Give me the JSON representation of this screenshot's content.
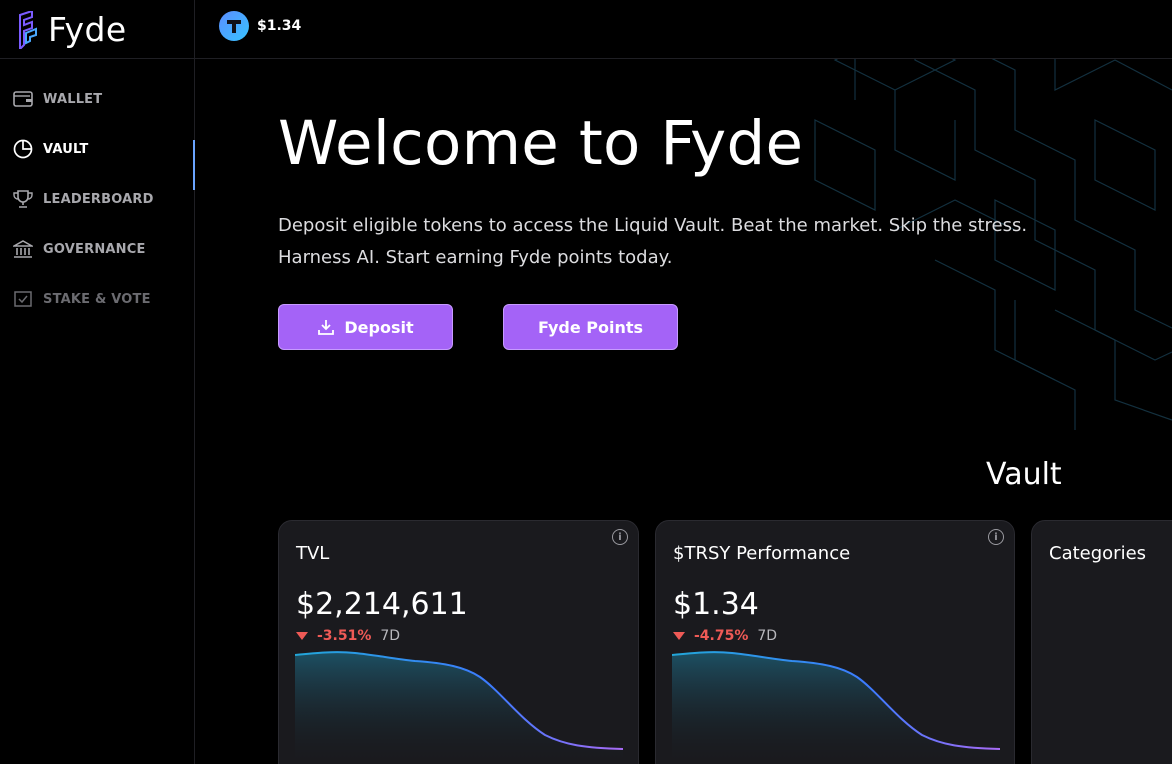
{
  "brand": {
    "name": "Fyde"
  },
  "header": {
    "token_price": "$1.34"
  },
  "sidebar": {
    "items": [
      {
        "label": "WALLET",
        "icon": "wallet-icon"
      },
      {
        "label": "VAULT",
        "icon": "pie-chart-icon",
        "active": true
      },
      {
        "label": "LEADERBOARD",
        "icon": "trophy-icon"
      },
      {
        "label": "GOVERNANCE",
        "icon": "bank-icon"
      },
      {
        "label": "STAKE & VOTE",
        "icon": "vote-icon"
      }
    ]
  },
  "hero": {
    "title": "Welcome to Fyde",
    "subtitle": "Deposit eligible tokens to access the Liquid Vault. Beat the market. Skip the stress. Harness AI. Start earning Fyde points today.",
    "deposit_label": "Deposit",
    "points_label": "Fyde Points"
  },
  "vault": {
    "title": "Vault",
    "cards": [
      {
        "title": "TVL",
        "value": "$2,214,611",
        "change": "-3.51%",
        "period": "7D"
      },
      {
        "title": "$TRSY Performance",
        "value": "$1.34",
        "change": "-4.75%",
        "period": "7D"
      },
      {
        "title": "Categories"
      }
    ]
  },
  "colors": {
    "accent": "#a463f7",
    "negative": "#ef5a56",
    "active_indicator": "#6aa4ff",
    "card_bg": "#1a1a1e"
  }
}
